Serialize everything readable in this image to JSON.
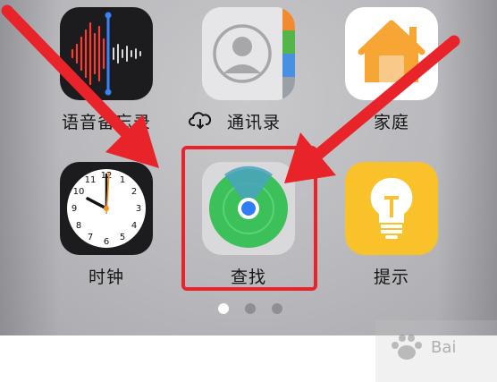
{
  "apps": {
    "voice_memos": {
      "label": "语音备忘录"
    },
    "contacts": {
      "label": "通讯录"
    },
    "home": {
      "label": "家庭"
    },
    "clock": {
      "label": "时钟"
    },
    "find_my": {
      "label": "查找"
    },
    "tips": {
      "label": "提示"
    }
  },
  "page_dots": {
    "count": 3,
    "active_index": 0
  },
  "icons": {
    "cloud_download": "cloud-download-icon",
    "arrow": "red-arrow"
  },
  "colors": {
    "highlight": "#e8242a",
    "find_my_green": "#3cc05a",
    "tips_yellow": "#f9c22b",
    "home_orange": "#f7a534"
  }
}
